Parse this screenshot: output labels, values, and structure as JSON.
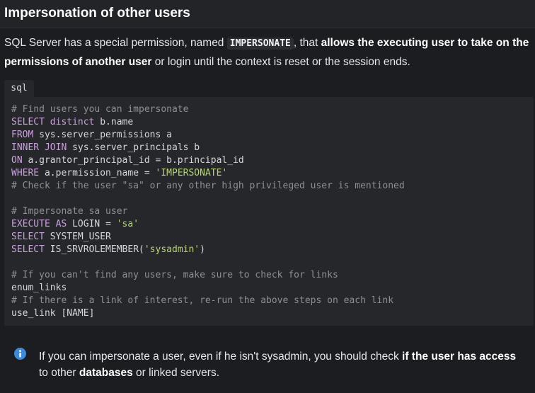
{
  "heading": "Impersonation of other users",
  "intro": {
    "before_code": "SQL Server has a special permission, named ",
    "code": "IMPERSONATE",
    "after_code": ", that ",
    "bold": "allows the executing user to take on the permissions of another user",
    "rest": " or login until the context is reset or the session ends."
  },
  "code_block": {
    "language": "sql",
    "lines": [
      [
        {
          "t": "comment",
          "v": "# Find users you can impersonate"
        }
      ],
      [
        {
          "t": "kw",
          "v": "SELECT distinct"
        },
        {
          "t": "plain",
          "v": " b.name"
        }
      ],
      [
        {
          "t": "kw",
          "v": "FROM"
        },
        {
          "t": "plain",
          "v": " sys.server_permissions a"
        }
      ],
      [
        {
          "t": "kw",
          "v": "INNER JOIN"
        },
        {
          "t": "plain",
          "v": " sys.server_principals b"
        }
      ],
      [
        {
          "t": "kw",
          "v": "ON"
        },
        {
          "t": "plain",
          "v": " a.grantor_principal_id = b.principal_id"
        }
      ],
      [
        {
          "t": "kw",
          "v": "WHERE"
        },
        {
          "t": "plain",
          "v": " a.permission_name = "
        },
        {
          "t": "str",
          "v": "'IMPERSONATE'"
        }
      ],
      [
        {
          "t": "comment",
          "v": "# Check if the user \"sa\" or any other high privileged user is mentioned"
        }
      ],
      [
        {
          "t": "plain",
          "v": ""
        }
      ],
      [
        {
          "t": "comment",
          "v": "# Impersonate sa user"
        }
      ],
      [
        {
          "t": "kw",
          "v": "EXECUTE AS"
        },
        {
          "t": "plain",
          "v": " LOGIN = "
        },
        {
          "t": "str",
          "v": "'sa'"
        }
      ],
      [
        {
          "t": "kw",
          "v": "SELECT"
        },
        {
          "t": "plain",
          "v": " SYSTEM_USER"
        }
      ],
      [
        {
          "t": "kw",
          "v": "SELECT"
        },
        {
          "t": "plain",
          "v": " IS_SRVROLEMEMBER("
        },
        {
          "t": "str",
          "v": "'sysadmin'"
        },
        {
          "t": "plain",
          "v": ")"
        }
      ],
      [
        {
          "t": "plain",
          "v": ""
        }
      ],
      [
        {
          "t": "comment",
          "v": "# If you can't find any users, make sure to check for links"
        }
      ],
      [
        {
          "t": "plain",
          "v": "enum_links"
        }
      ],
      [
        {
          "t": "comment",
          "v": "# If there is a link of interest, re-run the above steps on each link"
        }
      ],
      [
        {
          "t": "plain",
          "v": "use_link [NAME]"
        }
      ]
    ]
  },
  "callout": {
    "icon": "info-icon",
    "part1": "If you can impersonate a user, even if he isn't sysadmin, you should check ",
    "bold1": "if the user has access",
    "part2": " to other ",
    "bold2": "databases",
    "part3": " or linked servers."
  },
  "colors": {
    "background": "#1c1d21",
    "code_background": "#26272b",
    "keyword": "#c9a0dc",
    "string": "#b8d47a",
    "comment": "#8d8f96",
    "info_icon": "#3f8ad8"
  }
}
